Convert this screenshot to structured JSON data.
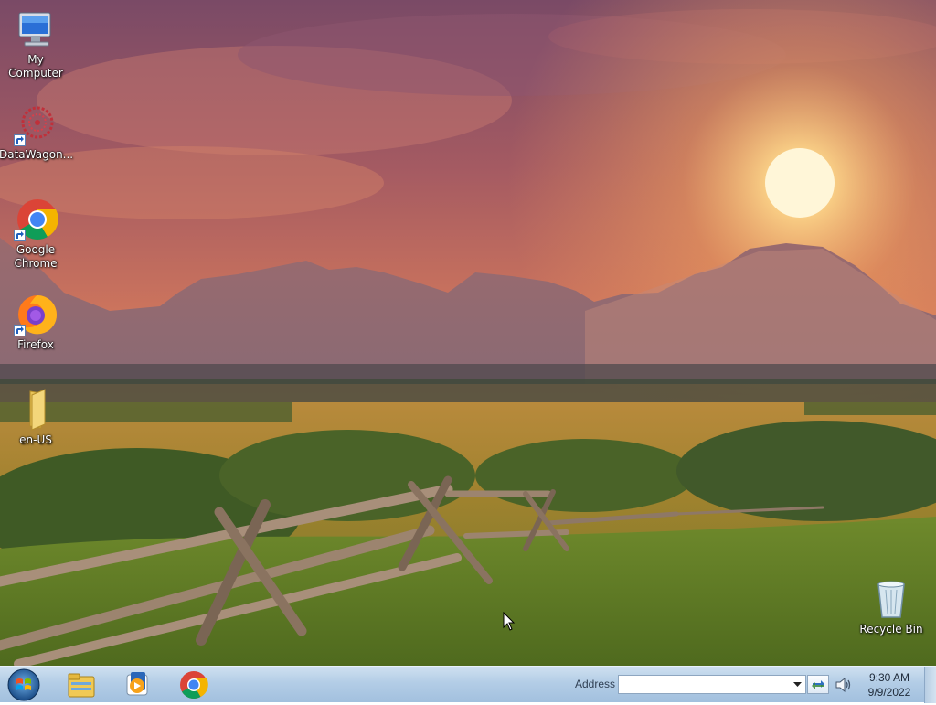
{
  "desktop": {
    "icons": [
      {
        "label": "My Computer",
        "icon": "computer-icon"
      },
      {
        "label": "DataWagon...",
        "icon": "datawagon-icon"
      },
      {
        "label": "Google Chrome",
        "icon": "chrome-icon"
      },
      {
        "label": "Firefox",
        "icon": "firefox-icon"
      },
      {
        "label": "en-US",
        "icon": "folder-icon"
      },
      {
        "label": "Recycle Bin",
        "icon": "recycle-bin-icon"
      }
    ]
  },
  "taskbar": {
    "pinned": [
      {
        "name": "Windows Explorer",
        "icon": "file-explorer-icon"
      },
      {
        "name": "Windows Media Player",
        "icon": "media-player-icon"
      },
      {
        "name": "Google Chrome",
        "icon": "chrome-icon"
      }
    ],
    "address": {
      "label": "Address",
      "value": ""
    },
    "clock": {
      "time": "9:30 AM",
      "date": "9/9/2022"
    }
  }
}
